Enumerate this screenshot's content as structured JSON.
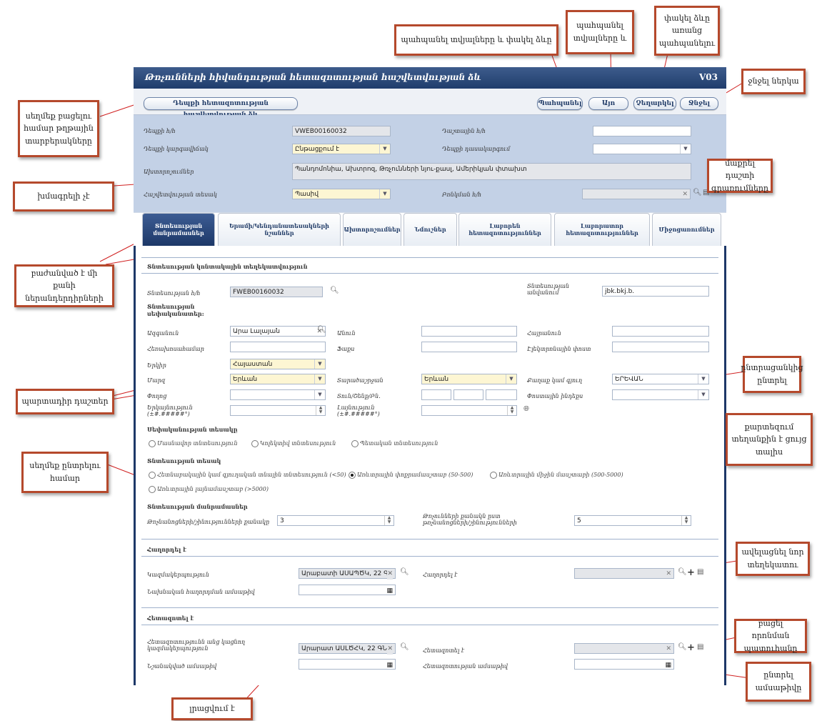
{
  "callouts": {
    "save_close": "պահպանել տվյալները և փակել ձևը",
    "save": "պահպանել\nտվյալները և",
    "close_nosave": "փակել ձևը\nառանց\nպահպանելու",
    "delete": "ջնջել ներկա",
    "open_list": "սեղմեք բացելու\nհամար թղթային\nտարբերակները",
    "clear": "մաքրել դաշտի\nգրառումները",
    "noedit": "խմագրելի չէ",
    "tabs_split": "բաժանված է մի քանի\nներանդերդիրների",
    "choose_list": "ընտրացանկից\nընտրել",
    "required": "պարտադիր դաշտեր",
    "map": "քարտեզում\nտեղանքին է ցույց\nտալիս",
    "radio_hint": "սեղմեք ընտրելու\nհամար",
    "add_new": "ավելացնել նոր\nտեղեկատու",
    "open_search": "բացել որոնման\nպատուհանը",
    "choose_date": "ընտրել\nամսաթիվը",
    "filled": "լրացվում է"
  },
  "form": {
    "title": "Թռչունների հիվանդության հետազոտության հաշվետվության ձև",
    "code": "V03",
    "toolbar": {
      "report_button": "Դեպքի հետազոտության հաշվետվության ձև",
      "save_close": "Պահպանել",
      "save": "Այո",
      "cancel": "Չեղարկել",
      "delete": "Ջնջել"
    },
    "header": {
      "case_no_label": "Դեպքի հ/հ",
      "case_no": "VWEB00160032",
      "field_no_label": "Դաշտային հ/հ",
      "case_status_label": "Դեպքի կարգավիճակ",
      "case_status": "Ընթացքում է",
      "case_class_label": "Դեպքի դասակարգում",
      "diagnosis_label": "Ախտորոշումներ",
      "diagnosis": "Պանդոմոնիա, Ախտրոզ, Թռչունների նյու-քասլ, Ամերիկյան փտախտ",
      "report_type_label": "Հաշվետվության տեսակ",
      "report_type": "Պասիվ",
      "session_label": "Բռնկման հ/հ"
    },
    "tabs": [
      "Տնտեսության\nմանրամասներ",
      "Երամի/Կենդանատեսակների\nնշաններ",
      "Ախտորոշումներ",
      "Նմուշներ",
      "Լաբորեն\nհետազոտություններ",
      "Լաբորատոր\nհետազոտություններ",
      "Միջոցառումներ"
    ],
    "farm": {
      "section_title": "Տնտեսության կոնտակային տեղեկատվություն",
      "farm_id_label": "Տնտեսության հ/հ",
      "farm_id": "FWEB00160032",
      "farm_name_label": "Տնտեսության անվանում",
      "farm_name": "jbk.bkj.b.",
      "owner_label": "Տնտեսության սեփականատեր:",
      "last_name_label": "Ազգանուն",
      "last_name": "Արա Լալայան",
      "first_name_label": "Անուն",
      "middle_name_label": "Հայրանուն",
      "phone_label": "Հեռախոսահամար",
      "fax_label": "Ֆաքս",
      "email_label": "Էլեկտրոնային փոստ",
      "country_label": "Երկիր",
      "country": "Հայաստան",
      "region_label": "Մարզ",
      "region": "Երևան",
      "district_label": "Տարածաշրջան",
      "district": "Երևան",
      "city_label": "Քաղաք կամ գյուղ",
      "city": "ԵՐԵՎԱՆ",
      "street_label": "Փողոց",
      "house_label": "Տուն/Շենք/Բն.",
      "postal_label": "Փոստային ինդեքս",
      "longitude_label": "Երկայնություն (±#.#####°)",
      "latitude_label": "Լայնություն (±#.#####°)",
      "ownership_title": "Սեփականության տեսակը",
      "ownership": [
        "Մասնավոր տնտեսություն",
        "Կոլեկտիվ տնտեսություն",
        "Պետական տնտեսություն"
      ],
      "type_title": "Տնտեսության տեսակ",
      "types": [
        "Հետնաբակային կամ գյուղական տնային տնտեսություն (<50)",
        "Առևտրային փոքրամասշտաբ (50-500)",
        "Առևտրային միջին մասշտաբի (500-5000)",
        "Առևտրային լայնամասշտաբ (>5000)"
      ],
      "details_title": "Տնտեսության մանրամասներ",
      "houses_label": "Թռչնանոցների/շինությունների քանակը",
      "houses": "3",
      "birds_label": "Թռչունների քանակն ըստ թռչնանոցների/շինությունների",
      "birds": "5"
    },
    "notified": {
      "section_title": "Հաղորդել է",
      "org_label": "Կազմակերպություն",
      "org": "Արաբատի ԱՍԱՊԾԿ, 22 Գ",
      "by_label": "Հաղորդել է",
      "date_label": "Նախնական հաղորդման ամսաթիվ"
    },
    "investigated": {
      "section_title": "Հետազոտել է",
      "org_label": "Հետազոտությունն անց կացնող կազմակերպություն",
      "org": "Արարատ ԱՍԼԾՀԿ, 22 ԳՆ",
      "by_label": "Հետազոտել է",
      "assigned_label": "Նշանակված ամսաթիվ",
      "date_label": "Հետազոտության ամսաթիվ"
    }
  }
}
